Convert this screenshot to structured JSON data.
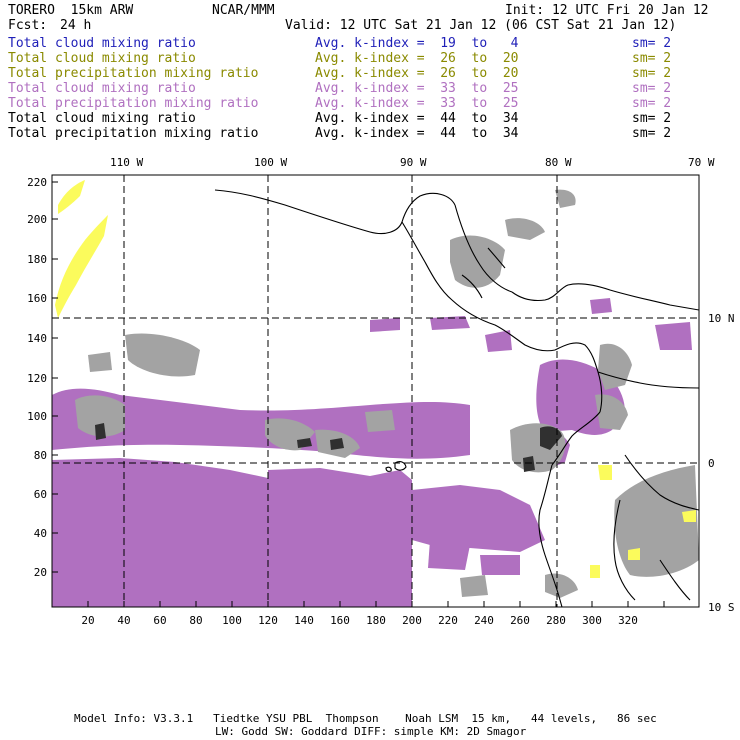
{
  "header": {
    "model": "TORERO  15km ARW",
    "org": "NCAR/MMM",
    "init": "Init: 12 UTC Fri 20 Jan 12",
    "fcst_label": "Fcst:",
    "fcst_value": "24 h",
    "valid": "Valid: 12 UTC Sat 21 Jan 12 (06 CST Sat 21 Jan 12)"
  },
  "legend": [
    {
      "field": "Total cloud mixing ratio",
      "kindex": "Avg. k-index =  19  to   4",
      "sm": "sm= 2",
      "color": "#1f1fb8"
    },
    {
      "field": "Total cloud mixing ratio",
      "kindex": "Avg. k-index =  26  to  20",
      "sm": "sm= 2",
      "color": "#8a8a00"
    },
    {
      "field": "Total precipitation mixing ratio",
      "kindex": "Avg. k-index =  26  to  20",
      "sm": "sm= 2",
      "color": "#8a8a00"
    },
    {
      "field": "Total cloud mixing ratio",
      "kindex": "Avg. k-index =  33  to  25",
      "sm": "sm= 2",
      "color": "#b070c0"
    },
    {
      "field": "Total precipitation mixing ratio",
      "kindex": "Avg. k-index =  33  to  25",
      "sm": "sm= 2",
      "color": "#b070c0"
    },
    {
      "field": "Total cloud mixing ratio",
      "kindex": "Avg. k-index =  44  to  34",
      "sm": "sm= 2",
      "color": "#000000"
    },
    {
      "field": "Total precipitation mixing ratio",
      "kindex": "Avg. k-index =  44  to  34",
      "sm": "sm= 2",
      "color": "#000000"
    }
  ],
  "axes": {
    "top_labels": [
      "110 W",
      "100 W",
      "90 W",
      "80 W",
      "70 W"
    ],
    "right_labels": [
      "10 N",
      "0",
      "10 S"
    ],
    "left_ticks": [
      "220",
      "200",
      "180",
      "160",
      "140",
      "120",
      "100",
      "80",
      "60",
      "40",
      "20"
    ],
    "bottom_ticks": [
      "20",
      "40",
      "60",
      "80",
      "100",
      "120",
      "140",
      "160",
      "180",
      "200",
      "220",
      "240",
      "260",
      "280",
      "300",
      "320"
    ]
  },
  "footer": {
    "line1": "Model Info: V3.3.1   Tiedtke YSU PBL  Thompson    Noah LSM  15 km,   44 levels,   86 sec",
    "line2": "LW: Godd SW: Goddard DIFF: simple KM: 2D Smagor"
  },
  "colors": {
    "precip_purple": "#b070c0",
    "cloud_gray": "#9c9c9c",
    "dark_core": "#303030",
    "yellow": "#fbfb5c"
  }
}
